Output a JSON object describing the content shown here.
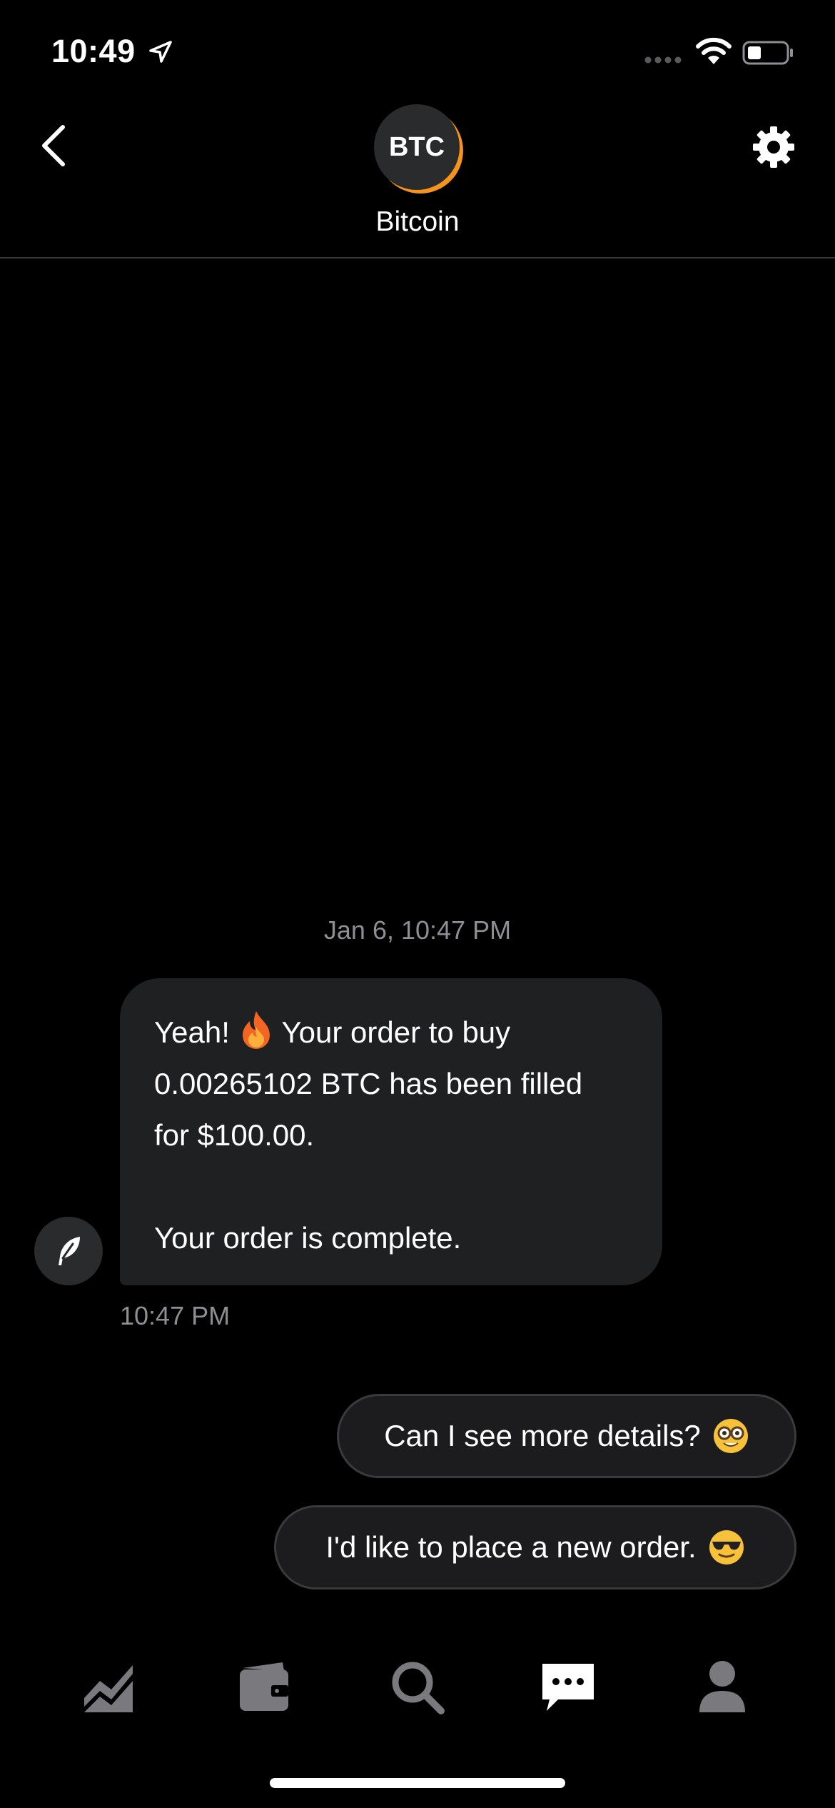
{
  "status_bar": {
    "time": "10:49",
    "icons": [
      "location-arrow-icon",
      "signal-dots-icon",
      "wifi-icon",
      "battery-icon"
    ]
  },
  "header": {
    "avatar_text": "BTC",
    "name": "Bitcoin",
    "icons": [
      "chevron-left-icon",
      "gear-icon"
    ]
  },
  "chat": {
    "date_stamp": "Jan 6, 10:47 PM",
    "bot_message": {
      "line1_prefix": "Yeah!",
      "line1_emoji": "fire-emoji",
      "line1_suffix": "Your order to buy",
      "line2": "0.00265102 BTC has been filled",
      "line3": "for $100.00.",
      "line5": "Your order is complete."
    },
    "bot_avatar_icon": "feather-icon",
    "message_time": "10:47 PM",
    "quick_replies": [
      {
        "label": "Can I see more details?",
        "emoji": "nerd-face-emoji"
      },
      {
        "label": "I'd like to place a new order.",
        "emoji": "sunglasses-face-emoji"
      }
    ]
  },
  "tab_bar": {
    "tabs": [
      {
        "icon": "stocks-chart-icon",
        "active": false
      },
      {
        "icon": "wallet-icon",
        "active": false
      },
      {
        "icon": "search-icon",
        "active": false
      },
      {
        "icon": "messages-icon",
        "active": true
      },
      {
        "icon": "account-icon",
        "active": false
      }
    ]
  },
  "colors": {
    "background": "#000000",
    "bubble": "#1f2022",
    "muted_text": "#8e8e93",
    "accent_orange": "#f7931a",
    "inactive_tab": "#7a7a7e",
    "active_tab": "#ffffff"
  }
}
